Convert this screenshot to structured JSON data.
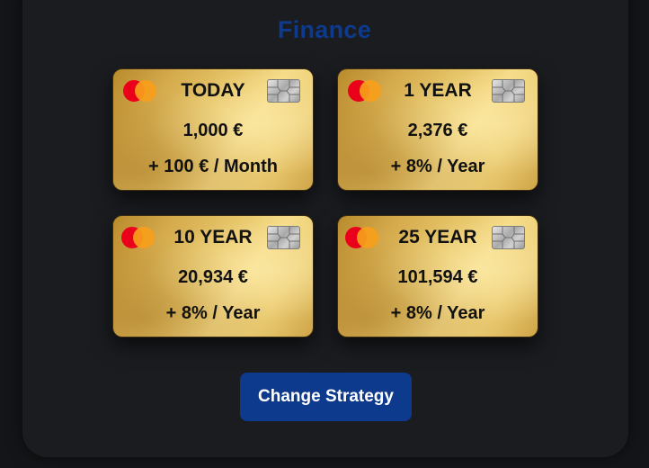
{
  "header": {
    "title": "Finance"
  },
  "cards": [
    {
      "label": "TODAY",
      "amount": "1,000 €",
      "rate": "+ 100 € / Month"
    },
    {
      "label": "1 YEAR",
      "amount": "2,376 €",
      "rate": "+ 8% / Year"
    },
    {
      "label": "10 YEAR",
      "amount": "20,934 €",
      "rate": "+ 8% / Year"
    },
    {
      "label": "25 YEAR",
      "amount": "101,594 €",
      "rate": "+ 8% / Year"
    }
  ],
  "card_icons": {
    "brand": "mastercard-icon",
    "chip": "card-chip-icon"
  },
  "actions": {
    "change_strategy_label": "Change Strategy"
  },
  "colors": {
    "title": "#0d3a8c",
    "button": "#0d3a8c",
    "card_gold": "#e7c66a",
    "background": "#1b1c20"
  }
}
